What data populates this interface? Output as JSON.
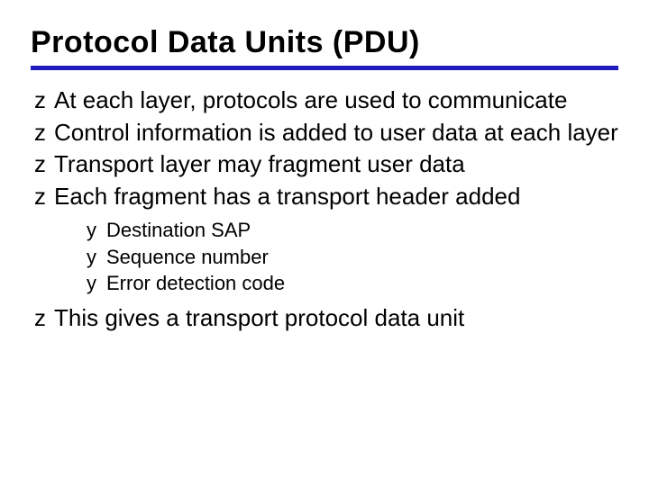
{
  "title": "Protocol Data Units (PDU)",
  "bullets": {
    "glyph_lvl1": "z",
    "glyph_lvl2": "y",
    "items": [
      {
        "text": "At each layer, protocols are used to communicate"
      },
      {
        "text": "Control information is added to user data at each layer"
      },
      {
        "text": "Transport layer may fragment user data"
      },
      {
        "text": "Each fragment has a transport header added",
        "sub": [
          {
            "text": "Destination SAP"
          },
          {
            "text": "Sequence number"
          },
          {
            "text": "Error detection code"
          }
        ]
      },
      {
        "text": "This gives a transport protocol data unit"
      }
    ]
  }
}
